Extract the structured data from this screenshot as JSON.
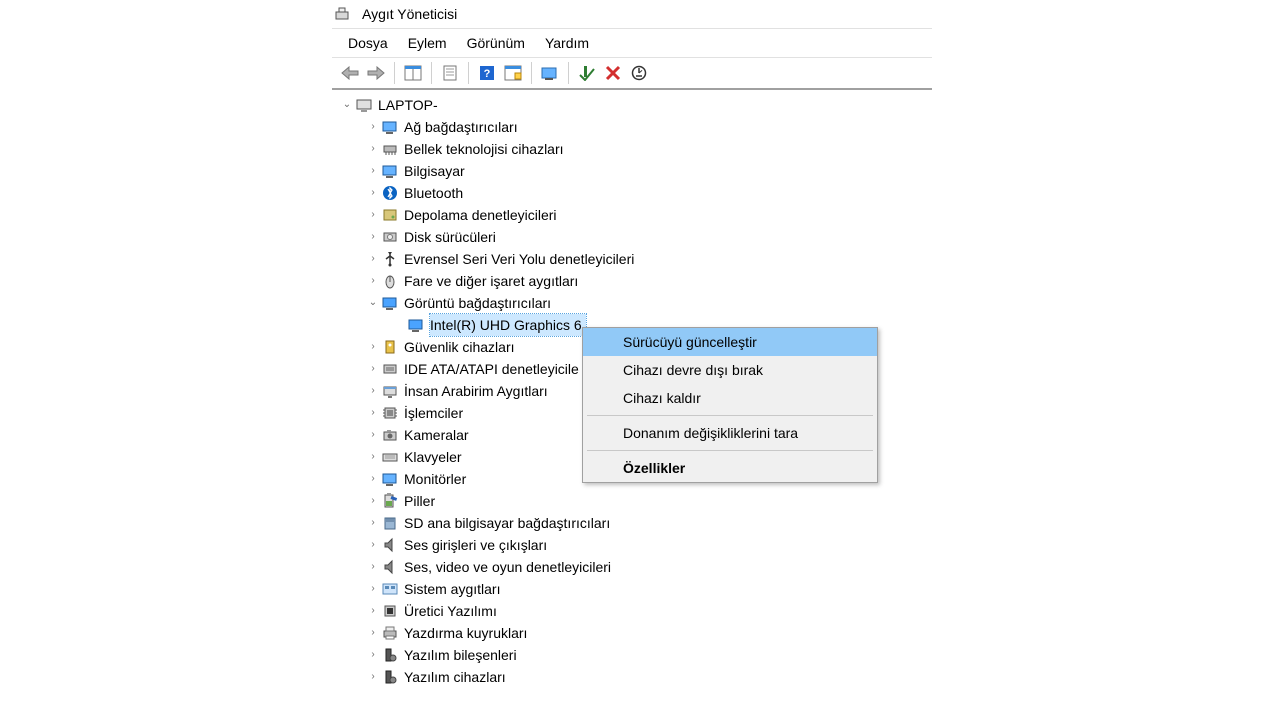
{
  "title": "Aygıt Yöneticisi",
  "menus": {
    "file": "Dosya",
    "action": "Eylem",
    "view": "Görünüm",
    "help": "Yardım"
  },
  "root": {
    "name": "LAPTOP-"
  },
  "categories": [
    {
      "label": "Ağ bağdaştırıcıları",
      "icon": "network"
    },
    {
      "label": "Bellek teknolojisi cihazları",
      "icon": "memory"
    },
    {
      "label": "Bilgisayar",
      "icon": "computer"
    },
    {
      "label": "Bluetooth",
      "icon": "bluetooth"
    },
    {
      "label": "Depolama denetleyicileri",
      "icon": "storage"
    },
    {
      "label": "Disk sürücüleri",
      "icon": "disk"
    },
    {
      "label": "Evrensel Seri Veri Yolu denetleyicileri",
      "icon": "usb"
    },
    {
      "label": "Fare ve diğer işaret aygıtları",
      "icon": "mouse"
    }
  ],
  "display_adapters": {
    "label": "Görüntü bağdaştırıcıları",
    "child": {
      "label": "Intel(R) UHD Graphics 6"
    }
  },
  "categories_after": [
    {
      "label": "Güvenlik cihazları",
      "icon": "security"
    },
    {
      "label": "IDE ATA/ATAPI denetleyicile",
      "icon": "ide"
    },
    {
      "label": "İnsan Arabirim Aygıtları",
      "icon": "hid"
    },
    {
      "label": "İşlemciler",
      "icon": "cpu"
    },
    {
      "label": "Kameralar",
      "icon": "camera"
    },
    {
      "label": "Klavyeler",
      "icon": "keyboard"
    },
    {
      "label": "Monitörler",
      "icon": "monitor"
    },
    {
      "label": "Piller",
      "icon": "battery"
    },
    {
      "label": "SD ana bilgisayar bağdaştırıcıları",
      "icon": "sd"
    },
    {
      "label": "Ses girişleri ve çıkışları",
      "icon": "audio"
    },
    {
      "label": "Ses, video ve oyun denetleyicileri",
      "icon": "audio"
    },
    {
      "label": "Sistem aygıtları",
      "icon": "system"
    },
    {
      "label": "Üretici Yazılımı",
      "icon": "firmware"
    },
    {
      "label": "Yazdırma kuyrukları",
      "icon": "printer"
    },
    {
      "label": "Yazılım bileşenleri",
      "icon": "software"
    },
    {
      "label": "Yazılım cihazları",
      "icon": "software"
    }
  ],
  "context_menu": {
    "update": "Sürücüyü güncelleştir",
    "disable": "Cihazı devre dışı bırak",
    "uninstall": "Cihazı kaldır",
    "scan": "Donanım değişikliklerini tara",
    "properties": "Özellikler"
  }
}
